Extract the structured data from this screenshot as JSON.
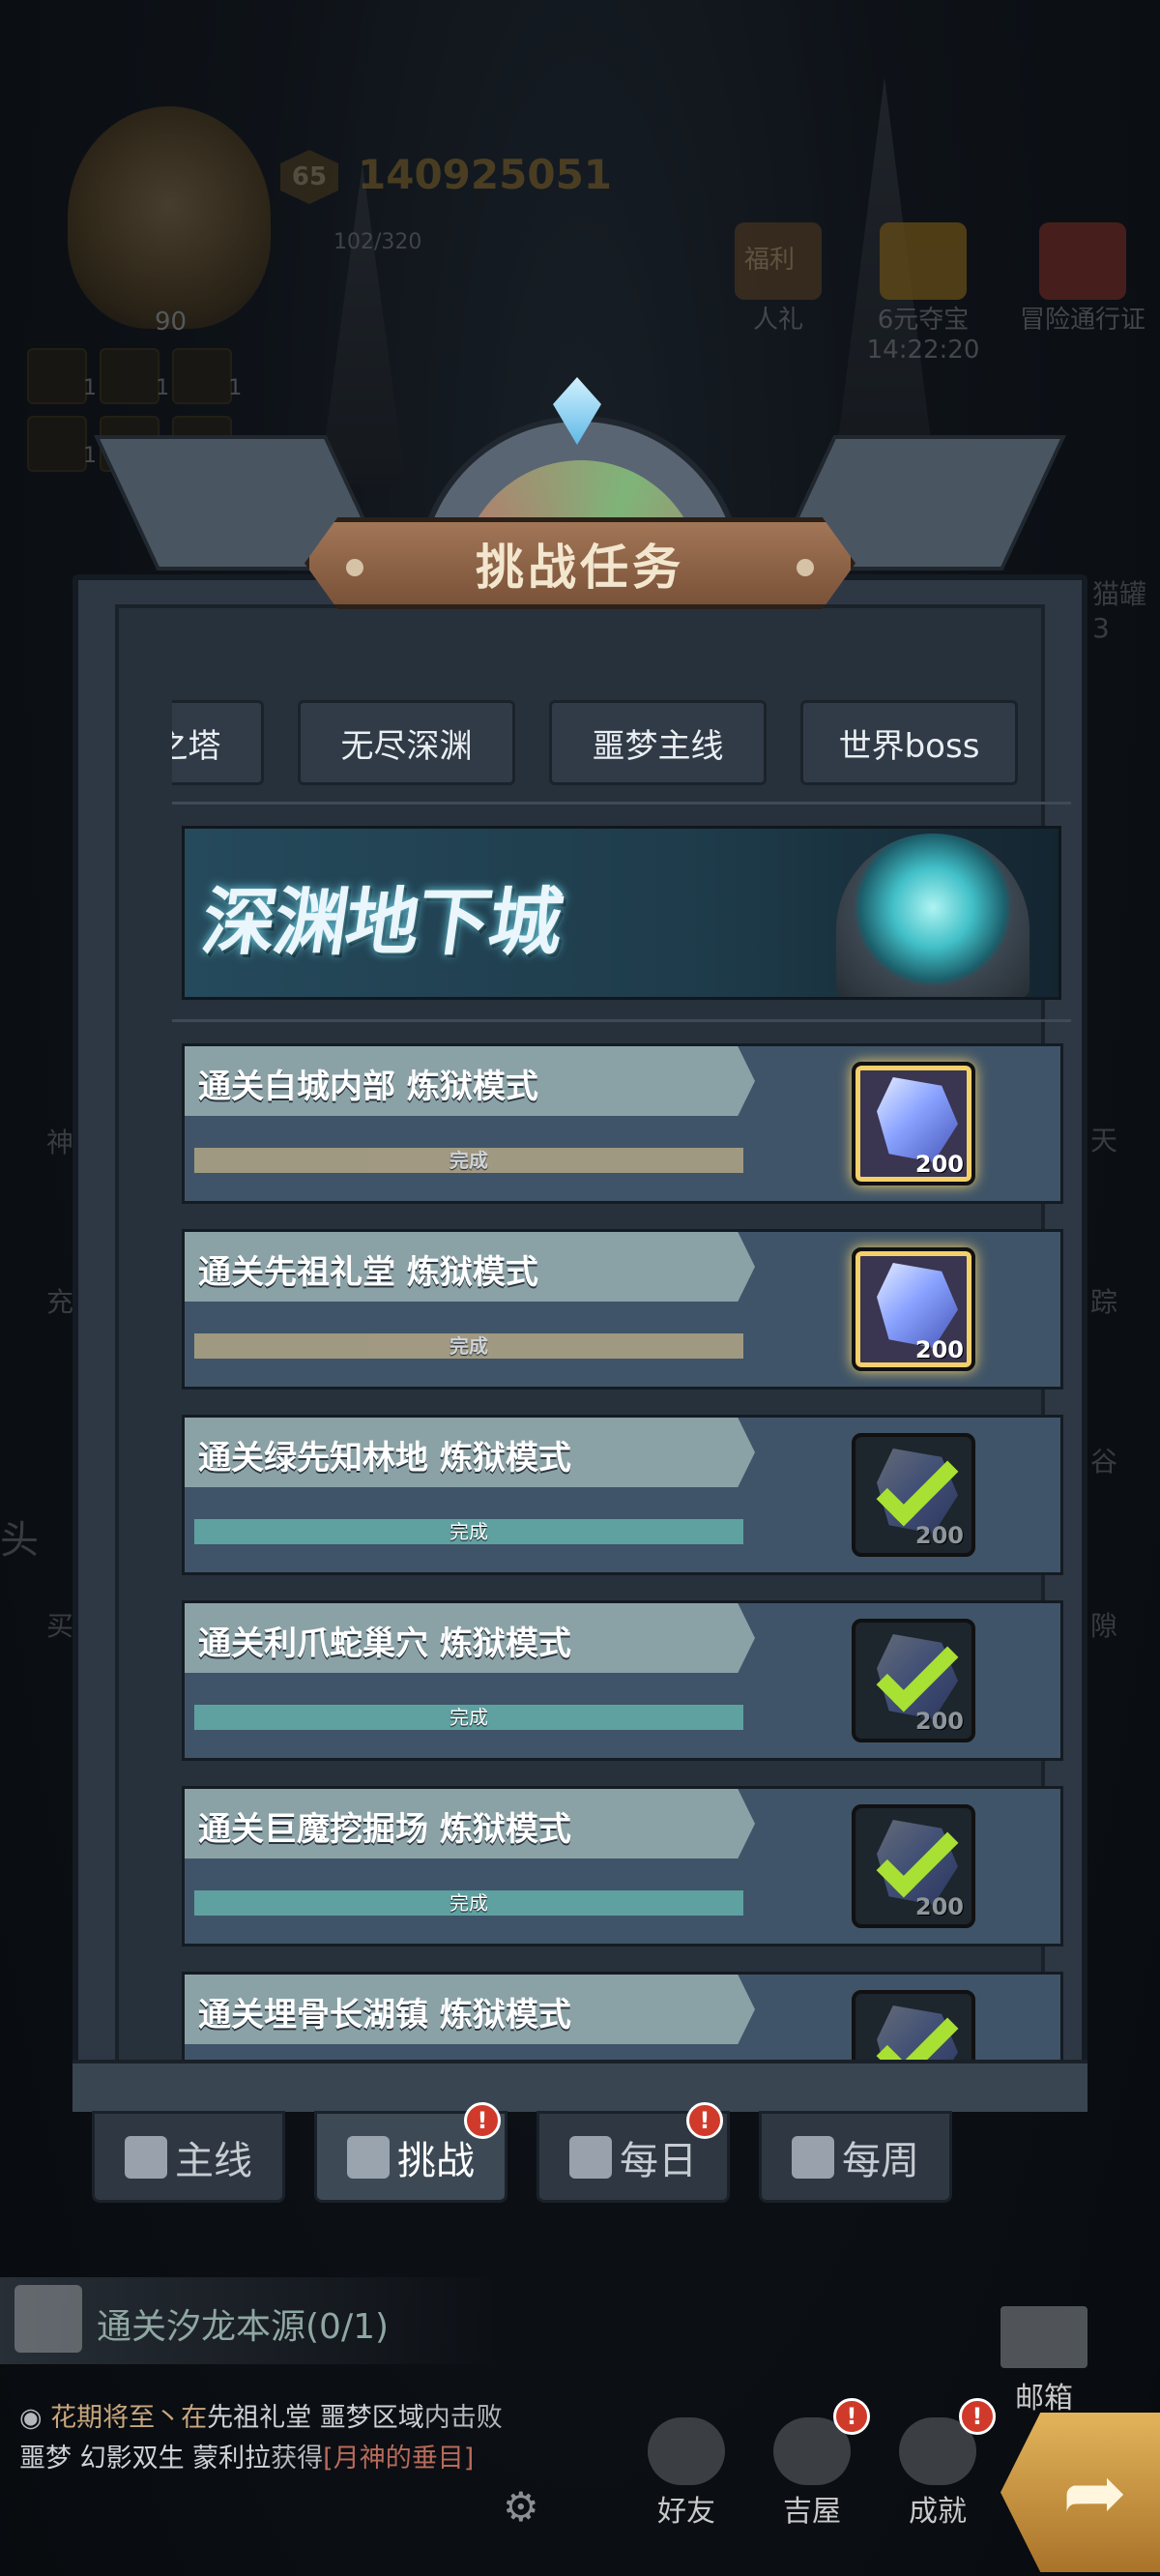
{
  "hud": {
    "player_level": "90",
    "level_badge": "65",
    "gold": "140925051",
    "stamina": "102/320",
    "buffs": [
      "1",
      "1",
      "1",
      "1",
      "1",
      "1"
    ],
    "top_icons": [
      {
        "label": "人礼",
        "tag": "福利"
      },
      {
        "label": "6元夺宝",
        "sub": "14:22:20"
      },
      {
        "label": "冒险通行证"
      }
    ],
    "side_labels": [
      "猫罐3",
      "天",
      "踪",
      "谷",
      "隙",
      "神",
      "充",
      "头",
      "买"
    ]
  },
  "modal": {
    "title": "挑战任务",
    "tabs": [
      {
        "label": "猫月之塔"
      },
      {
        "label": "无尽深渊"
      },
      {
        "label": "噩梦主线"
      },
      {
        "label": "世界boss"
      }
    ],
    "banner_text": "深渊地下城",
    "tasks": [
      {
        "title": "通关白城内部  炼狱模式",
        "status": "完成",
        "reward_qty": "200",
        "claimed": false
      },
      {
        "title": "通关先祖礼堂  炼狱模式",
        "status": "完成",
        "reward_qty": "200",
        "claimed": false
      },
      {
        "title": "通关绿先知林地  炼狱模式",
        "status": "完成",
        "reward_qty": "200",
        "claimed": true
      },
      {
        "title": "通关利爪蛇巢穴  炼狱模式",
        "status": "完成",
        "reward_qty": "200",
        "claimed": true
      },
      {
        "title": "通关巨魔挖掘场  炼狱模式",
        "status": "完成",
        "reward_qty": "200",
        "claimed": true
      },
      {
        "title": "通关埋骨长湖镇  炼狱模式",
        "status": "",
        "reward_qty": "",
        "claimed": true
      }
    ]
  },
  "mode_tabs": [
    {
      "label": "主线",
      "alert": false
    },
    {
      "label": "挑战",
      "alert": true
    },
    {
      "label": "每日",
      "alert": true
    },
    {
      "label": "每周",
      "alert": false
    }
  ],
  "quest_tracker": "通关汐龙本源(0/1)",
  "chat": {
    "prefix": "花期将至丶在",
    "location": "先祖礼堂 噩梦区域",
    "middle": "内击败",
    "enemies": "噩梦 幻影双生 蒙利拉",
    "obtain": "获得",
    "item": "[月神的垂目]"
  },
  "bottom_nav": [
    {
      "label": "好友",
      "alert": false
    },
    {
      "label": "吉屋",
      "alert": true
    },
    {
      "label": "成就",
      "alert": true
    }
  ],
  "mail_label": "邮箱",
  "alert_symbol": "!",
  "colors": {
    "accent_gold": "#f4d06a",
    "check_green": "#a8e034",
    "alert_red": "#d03a2a"
  }
}
